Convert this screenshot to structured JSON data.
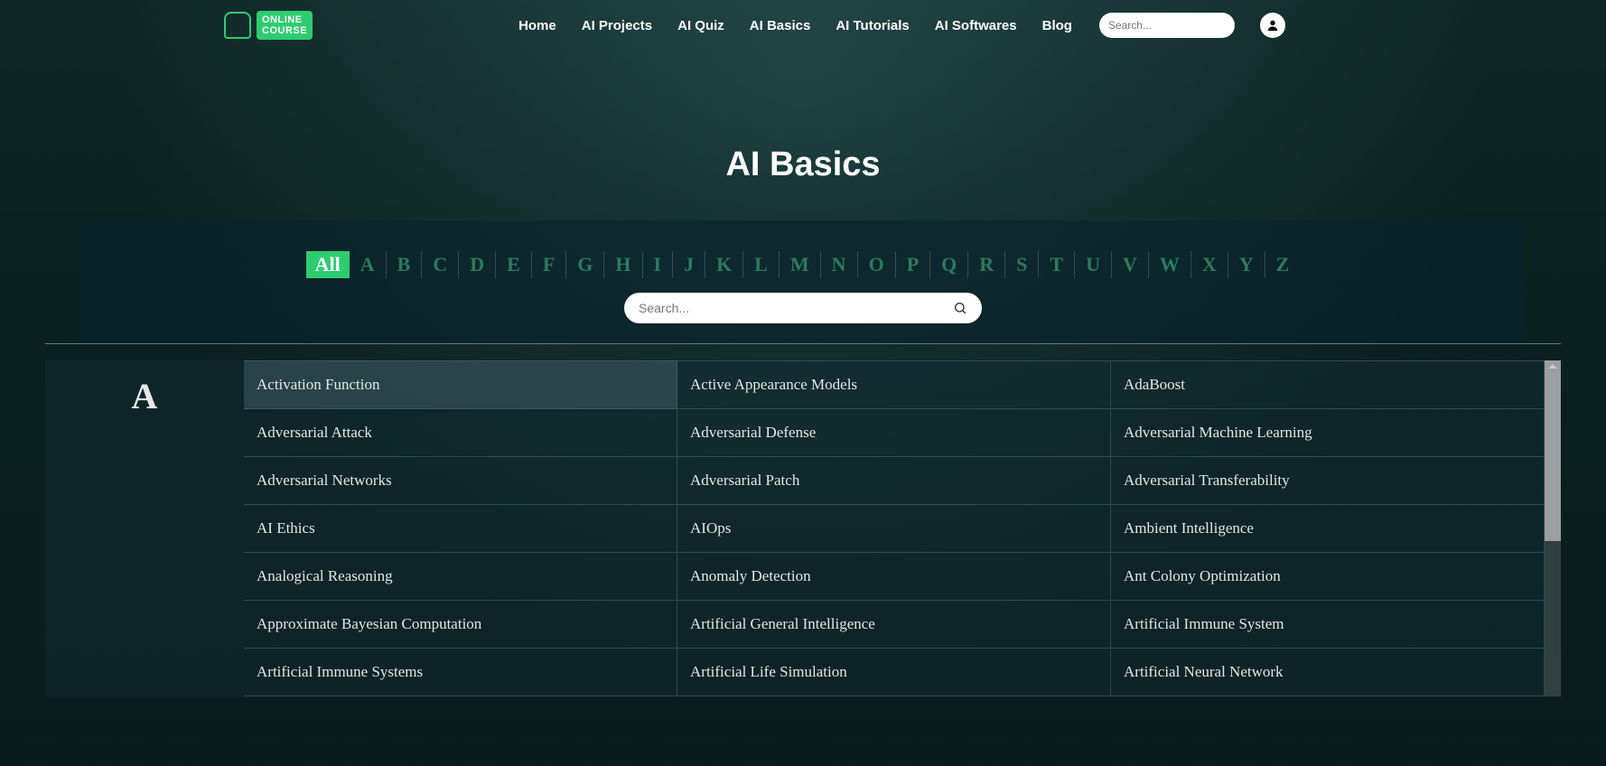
{
  "logo": {
    "line1": "ONLINE",
    "line2": "COURSE"
  },
  "nav": [
    "Home",
    "AI Projects",
    "AI Quiz",
    "AI Basics",
    "AI Tutorials",
    "AI Softwares",
    "Blog"
  ],
  "search_top_placeholder": "Search...",
  "hero_title": "AI Basics",
  "alpha": [
    "All",
    "A",
    "B",
    "C",
    "D",
    "E",
    "F",
    "G",
    "H",
    "I",
    "J",
    "K",
    "L",
    "M",
    "N",
    "O",
    "P",
    "Q",
    "R",
    "S",
    "T",
    "U",
    "V",
    "W",
    "X",
    "Y",
    "Z"
  ],
  "alpha_active": "All",
  "search_glossary_placeholder": "Search...",
  "section_letter": "A",
  "terms": [
    "Activation Function",
    "Active Appearance Models",
    "AdaBoost",
    "Adversarial Attack",
    "Adversarial Defense",
    "Adversarial Machine Learning",
    "Adversarial Networks",
    "Adversarial Patch",
    "Adversarial Transferability",
    "AI Ethics",
    "AIOps",
    "Ambient Intelligence",
    "Analogical Reasoning",
    "Anomaly Detection",
    "Ant Colony Optimization",
    "Approximate Bayesian Computation",
    "Artificial General Intelligence",
    "Artificial Immune System",
    "Artificial Immune Systems",
    "Artificial Life Simulation",
    "Artificial Neural Network"
  ],
  "hovered_term_index": 0
}
